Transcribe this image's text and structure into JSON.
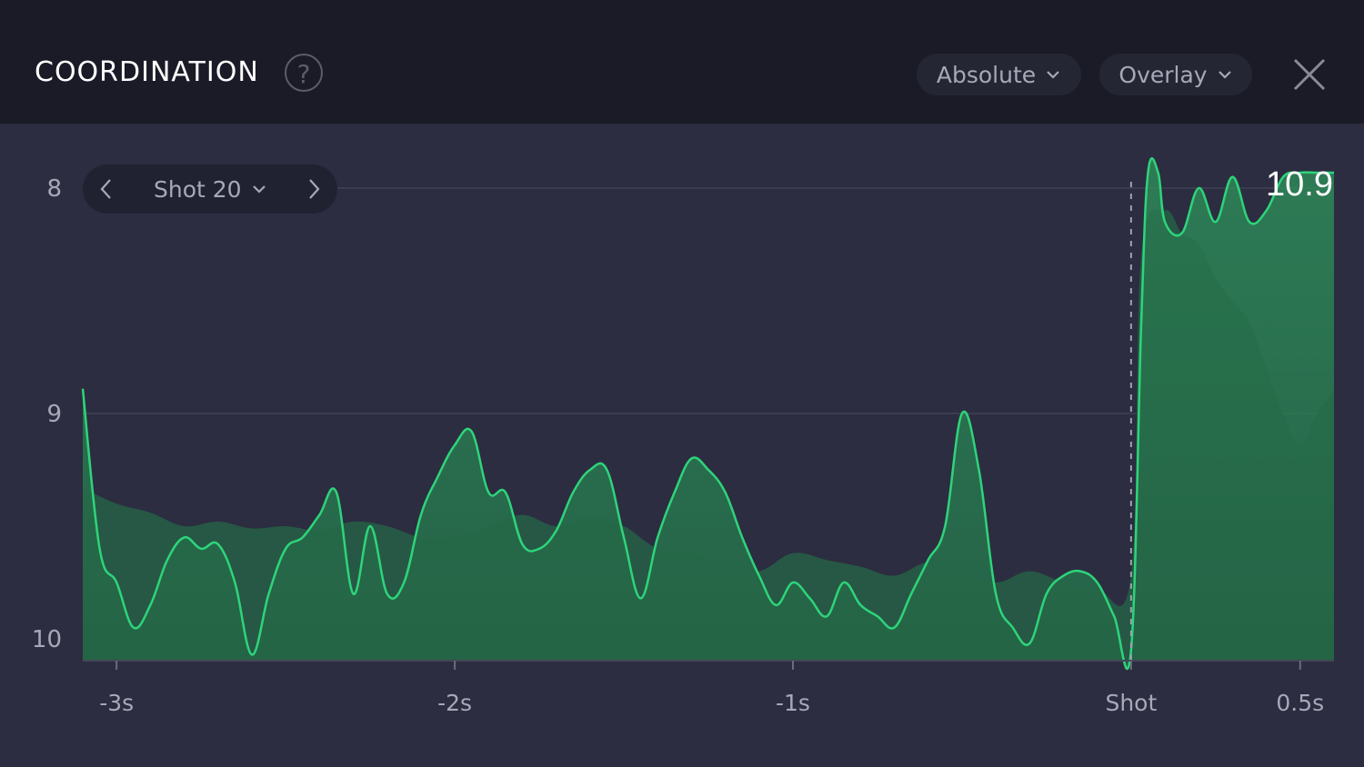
{
  "header": {
    "title": "COORDINATION",
    "help_symbol": "?",
    "mode_dropdown": "Absolute",
    "view_dropdown": "Overlay"
  },
  "shot_selector": {
    "label": "Shot 20"
  },
  "current_value": "10.9",
  "colors": {
    "line": "#2ed47a",
    "fill_light": "#2a8a55",
    "fill_dark": "#265746",
    "background": "#2c2d40",
    "header_bg": "#1a1b27"
  },
  "chart_data": {
    "type": "area",
    "y_ticks": [
      "8",
      "9",
      "10"
    ],
    "y_tick_values": [
      8,
      9,
      10
    ],
    "y_axis_inverted": true,
    "ylim": [
      10.1,
      7.9
    ],
    "x_ticks": [
      "-3s",
      "-2s",
      "-1s",
      "Shot",
      "0.5s"
    ],
    "x_tick_values": [
      -3,
      -2,
      -1,
      0,
      0.5
    ],
    "xlim": [
      -3.1,
      0.6
    ],
    "marker_x": 0,
    "series": [
      {
        "role": "current shot",
        "x": [
          -3.1,
          -3.05,
          -3.0,
          -2.95,
          -2.9,
          -2.85,
          -2.8,
          -2.75,
          -2.7,
          -2.65,
          -2.6,
          -2.55,
          -2.5,
          -2.45,
          -2.4,
          -2.35,
          -2.3,
          -2.25,
          -2.2,
          -2.15,
          -2.1,
          -2.05,
          -2.0,
          -1.95,
          -1.9,
          -1.85,
          -1.8,
          -1.75,
          -1.7,
          -1.65,
          -1.6,
          -1.55,
          -1.5,
          -1.45,
          -1.4,
          -1.35,
          -1.3,
          -1.25,
          -1.2,
          -1.15,
          -1.1,
          -1.05,
          -1.0,
          -0.95,
          -0.9,
          -0.85,
          -0.8,
          -0.75,
          -0.7,
          -0.65,
          -0.6,
          -0.55,
          -0.5,
          -0.45,
          -0.4,
          -0.35,
          -0.3,
          -0.25,
          -0.2,
          -0.15,
          -0.1,
          -0.05,
          0.0,
          0.03,
          0.05,
          0.08,
          0.1,
          0.15,
          0.2,
          0.25,
          0.3,
          0.35,
          0.4,
          0.45,
          0.5,
          0.55,
          0.6
        ],
        "values": [
          8.89,
          9.6,
          9.75,
          9.95,
          9.85,
          9.65,
          9.55,
          9.6,
          9.58,
          9.75,
          10.07,
          9.8,
          9.6,
          9.55,
          9.45,
          9.35,
          9.8,
          9.5,
          9.8,
          9.75,
          9.45,
          9.28,
          9.14,
          9.08,
          9.35,
          9.35,
          9.58,
          9.6,
          9.52,
          9.35,
          9.25,
          9.25,
          9.55,
          9.82,
          9.55,
          9.35,
          9.2,
          9.25,
          9.35,
          9.55,
          9.72,
          9.85,
          9.75,
          9.82,
          9.9,
          9.75,
          9.85,
          9.9,
          9.95,
          9.8,
          9.65,
          9.5,
          9.0,
          9.25,
          9.8,
          9.95,
          10.02,
          9.8,
          9.72,
          9.7,
          9.75,
          9.9,
          10.05,
          8.6,
          7.9,
          7.92,
          8.15,
          8.2,
          8.0,
          8.15,
          7.95,
          8.15,
          8.1,
          7.95,
          7.9,
          7.92,
          7.9
        ]
      },
      {
        "role": "overlay average",
        "x": [
          -3.1,
          -3.0,
          -2.9,
          -2.8,
          -2.7,
          -2.6,
          -2.5,
          -2.4,
          -2.3,
          -2.2,
          -2.1,
          -2.0,
          -1.9,
          -1.8,
          -1.7,
          -1.6,
          -1.5,
          -1.4,
          -1.3,
          -1.2,
          -1.1,
          -1.0,
          -0.9,
          -0.8,
          -0.7,
          -0.6,
          -0.5,
          -0.4,
          -0.3,
          -0.2,
          -0.1,
          0.0,
          0.03,
          0.1,
          0.15,
          0.2,
          0.25,
          0.3,
          0.35,
          0.4,
          0.45,
          0.5,
          0.55,
          0.6
        ],
        "values": [
          9.33,
          9.4,
          9.44,
          9.5,
          9.48,
          9.51,
          9.5,
          9.52,
          9.48,
          9.5,
          9.55,
          9.55,
          9.5,
          9.45,
          9.5,
          9.46,
          9.5,
          9.6,
          9.62,
          9.68,
          9.7,
          9.62,
          9.65,
          9.68,
          9.72,
          9.66,
          9.7,
          9.75,
          9.7,
          9.75,
          9.78,
          9.72,
          8.3,
          8.1,
          8.2,
          8.25,
          8.4,
          8.5,
          8.6,
          8.8,
          9.0,
          9.15,
          9.0,
          8.9
        ]
      }
    ]
  }
}
